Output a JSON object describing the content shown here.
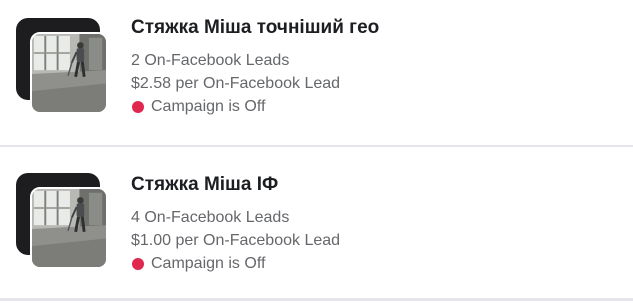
{
  "campaigns": [
    {
      "name": "Стяжка Міша точніший гео",
      "leads": "2 On-Facebook Leads",
      "cost_per_lead": "$2.58 per On-Facebook Lead",
      "status": "Campaign is Off",
      "status_color": "#e0284f",
      "thumbnail_icon": "construction-worker-photo"
    },
    {
      "name": "Стяжка Міша ІФ",
      "leads": "4 On-Facebook Leads",
      "cost_per_lead": "$1.00 per On-Facebook Lead",
      "status": "Campaign is Off",
      "status_color": "#e0284f",
      "thumbnail_icon": "construction-worker-photo"
    }
  ]
}
